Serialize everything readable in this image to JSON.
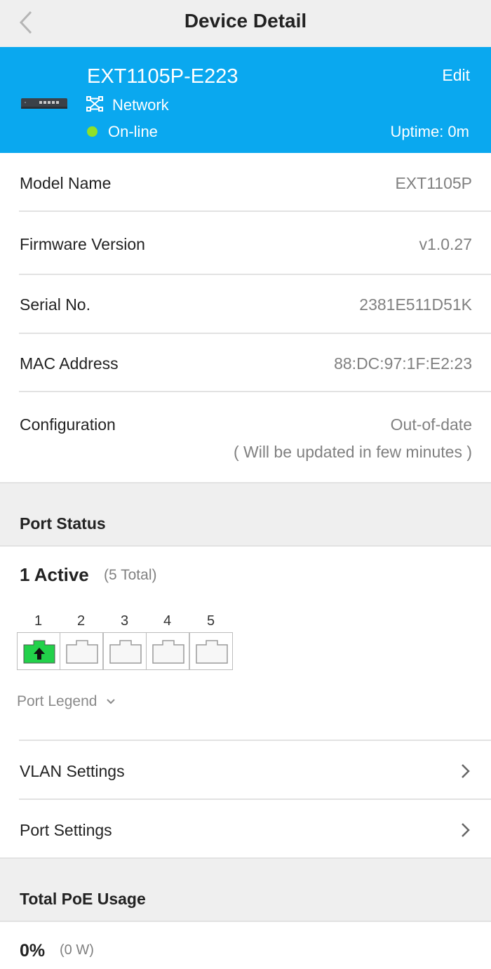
{
  "topbar": {
    "title": "Device Detail",
    "back_icon": "chevron-left-icon"
  },
  "device": {
    "name": "EXT1105P-E223",
    "edit_label": "Edit",
    "type_label": "Network",
    "status_label": "On-line",
    "status_color": "#8fe02a",
    "uptime": "Uptime: 0m",
    "accent_color": "#0aa8ef"
  },
  "details": [
    {
      "label": "Model Name",
      "value": "EXT1105P"
    },
    {
      "label": "Firmware Version",
      "value": "v1.0.27"
    },
    {
      "label": "Serial No.",
      "value": "2381E511D51K"
    },
    {
      "label": "MAC Address",
      "value": "88:DC:97:1F:E2:23"
    },
    {
      "label": "Configuration",
      "value": "Out-of-date",
      "note": "( Will be updated in few minutes )"
    }
  ],
  "port_status": {
    "title": "Port Status",
    "active": "1 Active",
    "total": "(5 Total)",
    "ports": [
      {
        "number": "1",
        "state": "active-uplink",
        "color": "#22d14a"
      },
      {
        "number": "2",
        "state": "inactive"
      },
      {
        "number": "3",
        "state": "inactive"
      },
      {
        "number": "4",
        "state": "inactive"
      },
      {
        "number": "5",
        "state": "inactive"
      }
    ],
    "legend_label": "Port Legend"
  },
  "menu": [
    {
      "label": "VLAN Settings"
    },
    {
      "label": "Port Settings"
    }
  ],
  "poe": {
    "title": "Total PoE Usage",
    "percent": "0%",
    "watts": "(0 W)"
  }
}
